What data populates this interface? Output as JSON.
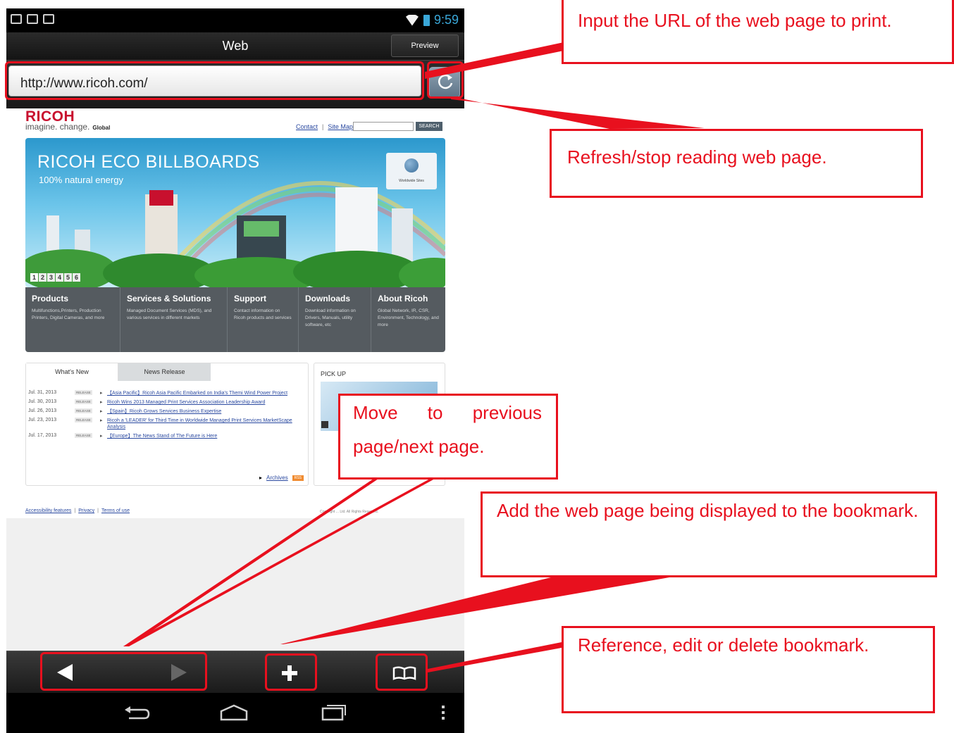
{
  "status_bar": {
    "time": "9:59"
  },
  "app": {
    "title": "Web",
    "preview_label": "Preview"
  },
  "url_bar": {
    "value": "http://www.ricoh.com/"
  },
  "webpage": {
    "logo": "RICOH",
    "tagline": "imagine. change.",
    "region": "Global",
    "top_links": [
      "Contact",
      "Site Map"
    ],
    "search_label": "SEARCH",
    "banner": {
      "title": "RICOH ECO BILLBOARDS",
      "subtitle": "100% natural energy",
      "worldwide_label": "Worldwide Sites",
      "pager": [
        "1",
        "2",
        "3",
        "4",
        "5",
        "6"
      ]
    },
    "nav_columns": [
      {
        "heading": "Products",
        "desc": "Multifunctions,Printers, Production Printers, Digital Cameras, and more"
      },
      {
        "heading": "Services & Solutions",
        "desc": "Managed Document Services (MDS), and various services in different markets"
      },
      {
        "heading": "Support",
        "desc": "Contact information on Ricoh products and services"
      },
      {
        "heading": "Downloads",
        "desc": "Download information on Drivers, Manuals, utility software, etc"
      },
      {
        "heading": "About Ricoh",
        "desc": "Global Network, IR, CSR, Environment, Technology, and more"
      }
    ],
    "news": {
      "tab_active": "What's New",
      "tab_inactive": "News Release",
      "release_badge": "RELEASE",
      "items": [
        {
          "date": "Jul. 31, 2013",
          "title": "【Asia Pacific】Ricoh Asia Pacific Embarked on India's Themi Wind Power Project"
        },
        {
          "date": "Jul. 30, 2013",
          "title": "Ricoh Wins 2013 Managed Print Services Association Leadership Award"
        },
        {
          "date": "Jul. 26, 2013",
          "title": "【Spain】Ricoh Grows Services Business Expertise"
        },
        {
          "date": "Jul. 23, 2013",
          "title": "Ricoh a 'LEADER' for Third Time in Worldwide Managed Print Services MarketScape Analysis"
        },
        {
          "date": "Jul. 17, 2013",
          "title": "【Europe】The News Stand of The Future is Here"
        }
      ],
      "archives_label": "Archives",
      "rss_label": "RSS"
    },
    "pickup_title": "PICK UP",
    "footer_links": [
      "Accessibility features",
      "Privacy",
      "Terms of use"
    ],
    "copyright": "Copyright ... Ltd. All Rights Reserved."
  },
  "annotations": {
    "url": "Input the URL of the web page to print.",
    "refresh": "Refresh/stop reading web page.",
    "move": "Move to previous page/next page.",
    "add_bookmark": "Add the web page being displayed to the bookmark.",
    "bookmark": "Reference, edit or delete bookmark."
  },
  "colors": {
    "annotation_red": "#e8101e",
    "ricoh_red": "#c8102e",
    "link_blue": "#2a49a0"
  }
}
